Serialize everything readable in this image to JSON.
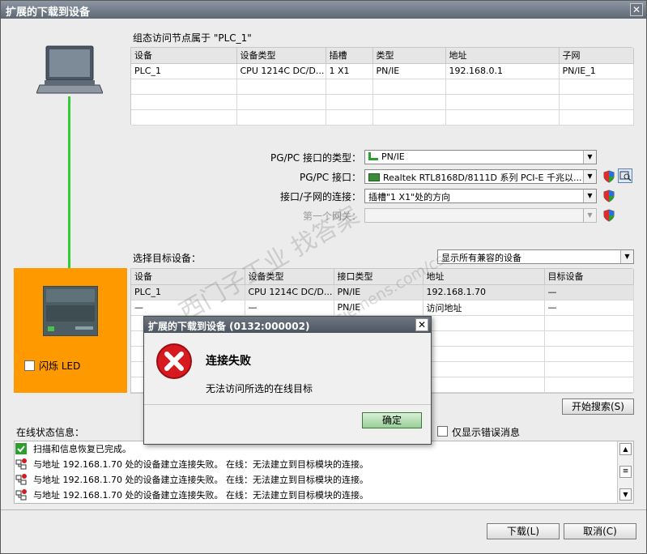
{
  "window": {
    "title": "扩展的下载到设备",
    "close_glyph": "✕"
  },
  "config_access": {
    "heading": "组态访问节点属于 \"PLC_1\"",
    "columns": [
      "设备",
      "设备类型",
      "插槽",
      "类型",
      "地址",
      "子网"
    ],
    "rows": [
      [
        "PLC_1",
        "CPU 1214C DC/D...",
        "1 X1",
        "PN/IE",
        "192.168.0.1",
        "PN/IE_1"
      ]
    ]
  },
  "interface": {
    "type_label": "PG/PC 接口的类型：",
    "type_value": "PN/IE",
    "pgpc_label": "PG/PC 接口：",
    "pgpc_value": "Realtek RTL8168D/8111D 系列 PCI-E 千兆以...",
    "subnet_label": "接口/子网的连接：",
    "subnet_value": "插槽\"1 X1\"处的方向",
    "gateway_label": "第一个网关：",
    "gateway_value": ""
  },
  "target": {
    "label": "选择目标设备：",
    "filter_value": "显示所有兼容的设备",
    "columns": [
      "设备",
      "设备类型",
      "接口类型",
      "地址",
      "目标设备"
    ],
    "rows": [
      [
        "PLC_1",
        "CPU 1214C DC/D...",
        "PN/IE",
        "192.168.1.70",
        "—"
      ],
      [
        "—",
        "—",
        "PN/IE",
        "访问地址",
        "—"
      ]
    ]
  },
  "flash_led_label": "闪烁 LED",
  "start_search_label": "开始搜索(S)",
  "show_errors_label": "仅显示错误消息",
  "status": {
    "label": "在线状态信息：",
    "messages": [
      {
        "text": "扫描和信息恢复已完成。",
        "icon": "check-icon"
      },
      {
        "text": "与地址 192.168.1.70 处的设备建立连接失败。 在线：无法建立到目标模块的连接。",
        "icon": "network-error-icon"
      },
      {
        "text": "与地址 192.168.1.70 处的设备建立连接失败。 在线：无法建立到目标模块的连接。",
        "icon": "network-error-icon"
      },
      {
        "text": "与地址 192.168.1.70 处的设备建立连接失败。 在线：无法建立到目标模块的连接。",
        "icon": "network-error-icon"
      }
    ]
  },
  "footer": {
    "download_label": "下载(L)",
    "cancel_label": "取消(C)"
  },
  "dialog": {
    "title": "扩展的下载到设备 (0132:000002)",
    "heading": "连接失败",
    "message": "无法访问所选的在线目标",
    "ok_label": "确定",
    "close_glyph": "✕"
  },
  "watermark": {
    "line1": "西门子工业 找答案",
    "line2": "support.industry.siemens.com/cs"
  },
  "colors": {
    "title_bar": "#6c7682",
    "device_highlight": "#ff9900",
    "link_line": "#33cc33",
    "error_red": "#d71920",
    "ok_green": "#2e9e2e"
  }
}
